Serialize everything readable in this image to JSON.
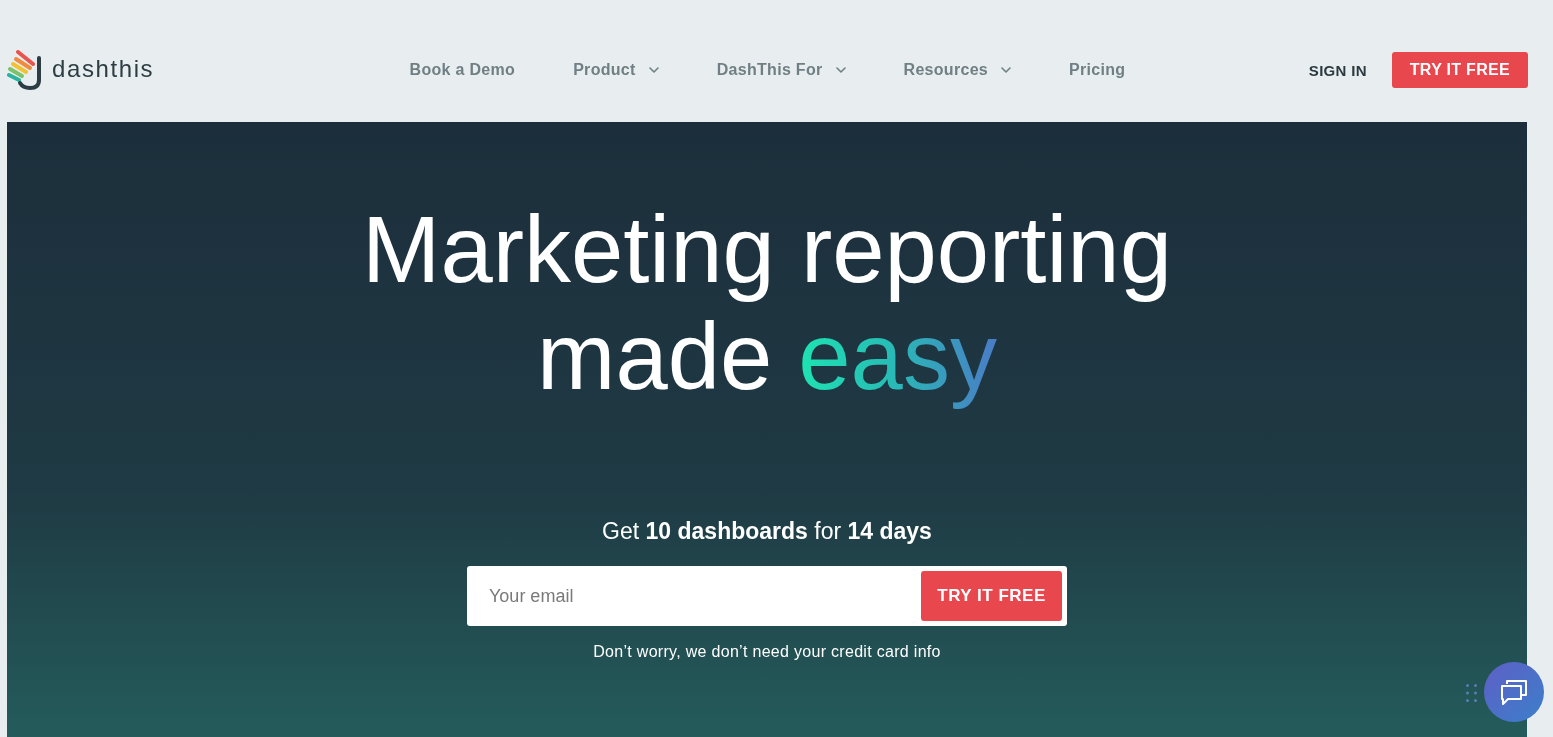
{
  "header": {
    "logo": {
      "text": "dashthis"
    },
    "nav": [
      {
        "label": "Book a Demo",
        "has_dropdown": false
      },
      {
        "label": "Product",
        "has_dropdown": true
      },
      {
        "label": "DashThis For",
        "has_dropdown": true
      },
      {
        "label": "Resources",
        "has_dropdown": true
      },
      {
        "label": "Pricing",
        "has_dropdown": false
      }
    ],
    "sign_in": "SIGN IN",
    "cta": "TRY IT FREE"
  },
  "hero": {
    "headline": {
      "line_1": "Marketing reporting",
      "line_2": "made",
      "highlight": "easy"
    },
    "offer": "Get **10 dashboards** for **14 days**",
    "signup": {
      "placeholder": "Your email",
      "button": "TRY IT FREE"
    },
    "note": "Don’t worry, we don’t need your credit card info"
  }
}
